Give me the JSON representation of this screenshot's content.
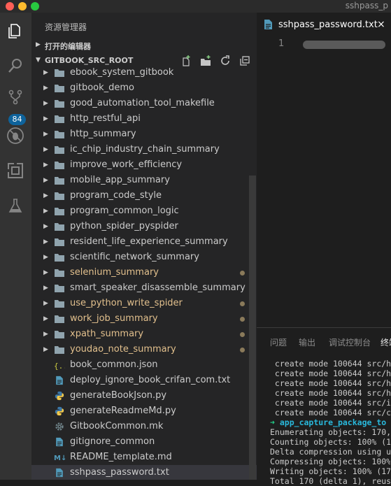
{
  "window": {
    "title": "sshpass_p",
    "traffic_lights": [
      "#ff5f57",
      "#febc2e",
      "#28c840"
    ]
  },
  "activity_bar": {
    "items": [
      "explorer-icon",
      "search-icon",
      "source-control-icon",
      "debug-icon",
      "extensions-icon",
      "lab-flask-icon"
    ],
    "scm_badge": "84"
  },
  "sidebar": {
    "title": "资源管理器",
    "open_editors_label": "打开的编辑器",
    "root_label": "GITBOOK_SRC_ROOT",
    "items": [
      {
        "name": "ebook_system_gitbook",
        "type": "folder",
        "modified": false
      },
      {
        "name": "gitbook_demo",
        "type": "folder",
        "modified": false
      },
      {
        "name": "good_automation_tool_makefile",
        "type": "folder",
        "modified": false
      },
      {
        "name": "http_restful_api",
        "type": "folder",
        "modified": false
      },
      {
        "name": "http_summary",
        "type": "folder",
        "modified": false
      },
      {
        "name": "ic_chip_industry_chain_summary",
        "type": "folder",
        "modified": false
      },
      {
        "name": "improve_work_efficiency",
        "type": "folder",
        "modified": false
      },
      {
        "name": "mobile_app_summary",
        "type": "folder",
        "modified": false
      },
      {
        "name": "program_code_style",
        "type": "folder",
        "modified": false
      },
      {
        "name": "program_common_logic",
        "type": "folder",
        "modified": false
      },
      {
        "name": "python_spider_pyspider",
        "type": "folder",
        "modified": false
      },
      {
        "name": "resident_life_experience_summary",
        "type": "folder",
        "modified": false
      },
      {
        "name": "scientific_network_summary",
        "type": "folder",
        "modified": false
      },
      {
        "name": "selenium_summary",
        "type": "folder",
        "modified": true
      },
      {
        "name": "smart_speaker_disassemble_summary",
        "type": "folder",
        "modified": false
      },
      {
        "name": "use_python_write_spider",
        "type": "folder",
        "modified": true
      },
      {
        "name": "work_job_summary",
        "type": "folder",
        "modified": true
      },
      {
        "name": "xpath_summary",
        "type": "folder",
        "modified": true
      },
      {
        "name": "youdao_note_summary",
        "type": "folder",
        "modified": true
      },
      {
        "name": "book_common.json",
        "type": "json",
        "modified": false
      },
      {
        "name": "deploy_ignore_book_crifan_com.txt",
        "type": "text",
        "modified": false
      },
      {
        "name": "generateBookJson.py",
        "type": "python",
        "modified": false
      },
      {
        "name": "generateReadmeMd.py",
        "type": "python",
        "modified": false
      },
      {
        "name": "GitbookCommon.mk",
        "type": "gear",
        "modified": false
      },
      {
        "name": "gitignore_common",
        "type": "text",
        "modified": false
      },
      {
        "name": "README_template.md",
        "type": "markdown",
        "modified": false
      },
      {
        "name": "sshpass_password.txt",
        "type": "text",
        "modified": false,
        "selected": true
      }
    ]
  },
  "editor": {
    "tab_title": "sshpass_password.txt",
    "close_glyph": "×",
    "line_number": "1"
  },
  "panel": {
    "tabs": [
      "问题",
      "输出",
      "调试控制台",
      "终端"
    ],
    "active_tab": "终端",
    "terminal_lines": [
      " create mode 100644 src/h",
      " create mode 100644 src/h",
      " create mode 100644 src/h",
      " create mode 100644 src/h",
      " create mode 100644 src/i",
      " create mode 100644 src/c"
    ],
    "prompt_arrow": "➜",
    "prompt_path": "app_capture_package_to",
    "output_lines": [
      "Enumerating objects: 170,",
      "Counting objects: 100% (1",
      "Delta compression using u",
      "Compressing objects: 100%",
      "Writing objects: 100% (17",
      "Total 170 (delta 1), reus"
    ]
  },
  "colors": {
    "modified_text": "#e2c08d",
    "folder_icon": "#90a4ae",
    "badge_bg": "#0e639c",
    "terminal_arrow": "#23d18b",
    "terminal_path": "#29b8db"
  }
}
